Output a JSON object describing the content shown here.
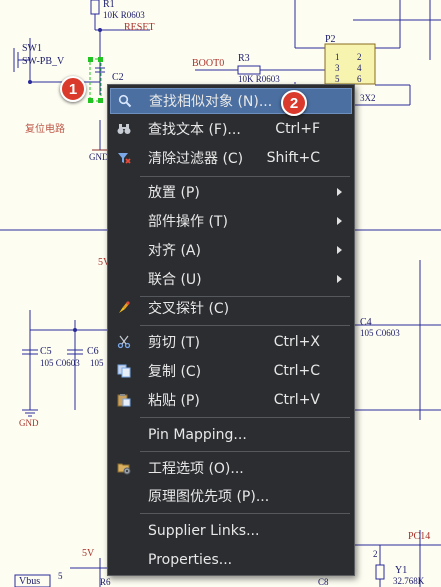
{
  "schematic": {
    "labels": {
      "r1": "R1",
      "r1_value": "10K R0603",
      "reset": "RESET",
      "sw1": "SW1",
      "sw1_type": "SW-PB_V",
      "c2": "C2",
      "reset_circuit": "复位电路",
      "gnd_top": "GND",
      "gnd_bottom": "GND",
      "boot0": "BOOT0",
      "r3": "R3",
      "r3_value": "10K R0603",
      "p2": "P2",
      "p2_pins": [
        "1",
        "2",
        "3",
        "4",
        "5",
        "6"
      ],
      "header_3x2": "3X2",
      "c4": "C4",
      "c4_value": "105 C0603",
      "c5": "C5",
      "c5_value": "105 C0603",
      "c6": "C6",
      "c6_value": "105",
      "net_5v_top": "5V",
      "net_5v_bottom": "5V",
      "vbus": "Vbus",
      "vbus_pin": "5",
      "r6": "R6",
      "pc14": "PC14",
      "y1": "Y1",
      "y1_value": "32.768K",
      "c8": "C8",
      "crystal_pin": "2"
    }
  },
  "badges": {
    "one": "1",
    "two": "2"
  },
  "menu": {
    "items": [
      {
        "icon": "search-icon",
        "label": "查找相似对象 (N)...",
        "shortcut": "",
        "submenu": false,
        "highlighted": true
      },
      {
        "icon": "binoculars-icon",
        "label": "查找文本 (F)...",
        "shortcut": "Ctrl+F",
        "submenu": false
      },
      {
        "icon": "clear-filter-icon",
        "label": "清除过滤器 (C)",
        "shortcut": "Shift+C",
        "submenu": false
      },
      {
        "icon": "",
        "label": "放置 (P)",
        "shortcut": "",
        "submenu": true
      },
      {
        "icon": "",
        "label": "部件操作 (T)",
        "shortcut": "",
        "submenu": true
      },
      {
        "icon": "",
        "label": "对齐 (A)",
        "shortcut": "",
        "submenu": true
      },
      {
        "icon": "",
        "label": "联合 (U)",
        "shortcut": "",
        "submenu": true
      },
      {
        "icon": "cross-probe-icon",
        "label": "交叉探针 (C)",
        "shortcut": "",
        "submenu": false
      },
      {
        "icon": "scissors-icon",
        "label": "剪切 (T)",
        "shortcut": "Ctrl+X",
        "submenu": false
      },
      {
        "icon": "copy-icon",
        "label": "复制 (C)",
        "shortcut": "Ctrl+C",
        "submenu": false
      },
      {
        "icon": "paste-icon",
        "label": "粘贴 (P)",
        "shortcut": "Ctrl+V",
        "submenu": false
      },
      {
        "icon": "",
        "label": "Pin Mapping...",
        "shortcut": "",
        "submenu": false
      },
      {
        "icon": "project-options-icon",
        "label": "工程选项 (O)...",
        "shortcut": "",
        "submenu": false
      },
      {
        "icon": "",
        "label": "原理图优先项 (P)...",
        "shortcut": "",
        "submenu": false
      },
      {
        "icon": "",
        "label": "Supplier Links...",
        "shortcut": "",
        "submenu": false
      },
      {
        "icon": "",
        "label": "Properties...",
        "shortcut": "",
        "submenu": false
      }
    ]
  }
}
